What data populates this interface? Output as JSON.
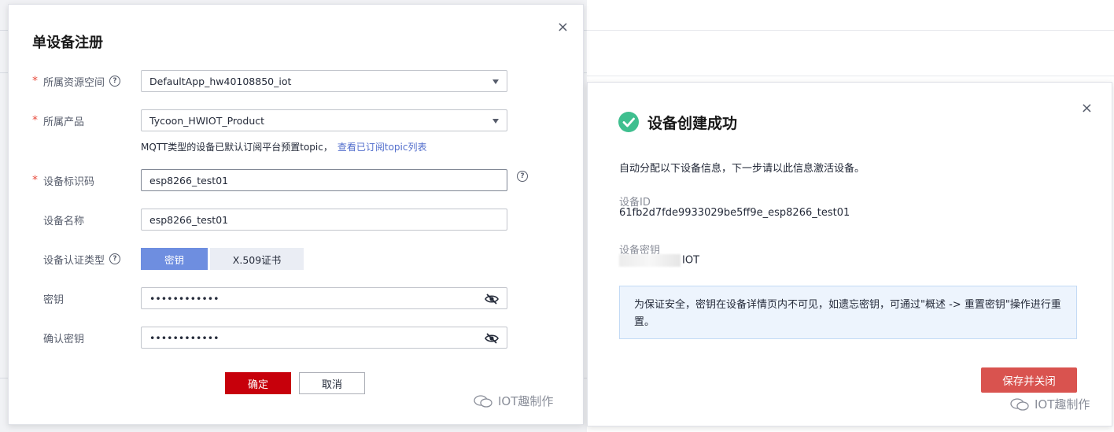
{
  "background": {
    "top_text": "·········· ·········· ···"
  },
  "left_dialog": {
    "title": "单设备注册",
    "close_glyph": "×",
    "fields": {
      "resource_space": {
        "label": "所属资源空间",
        "value": "DefaultApp_hw40108850_iot"
      },
      "product": {
        "label": "所属产品",
        "value": "Tycoon_HWIOT_Product"
      },
      "hint_text": "MQTT类型的设备已默认订阅平台预置topic，",
      "hint_link": "查看已订阅topic列表",
      "device_identifier": {
        "label": "设备标识码",
        "value": "esp8266_test01"
      },
      "device_name": {
        "label": "设备名称",
        "value": "esp8266_test01"
      },
      "auth_type": {
        "label": "设备认证类型",
        "options": [
          "密钥",
          "X.509证书"
        ],
        "selected": "密钥"
      },
      "secret": {
        "label": "密钥",
        "value": "••••••••••••"
      },
      "confirm_secret": {
        "label": "确认密钥",
        "value": "••••••••••••"
      }
    },
    "required_mark": "*",
    "ok_label": "确定",
    "cancel_label": "取消"
  },
  "right_dialog": {
    "title": "设备创建成功",
    "close_glyph": "×",
    "intro": "自动分配以下设备信息，下一步请以此信息激活设备。",
    "device_id_label": "设备ID",
    "device_id_value": "61fb2d7fde9933029be5ff9e_esp8266_test01",
    "device_secret_label": "设备密钥",
    "device_secret_visible_suffix": "IOT",
    "notice": "为保证安全，密钥在设备详情页内不可见，如遗忘密钥，可通过\"概述 -> 重置密钥\"操作进行重置。",
    "save_close_label": "保存并关闭"
  },
  "watermark": {
    "text": "IOT趣制作"
  },
  "colors": {
    "primary_red": "#c7000b",
    "segment_active": "#6e8ee0",
    "link": "#526ecc",
    "success_green": "#3fbf8f",
    "save_button": "#d9534f"
  }
}
